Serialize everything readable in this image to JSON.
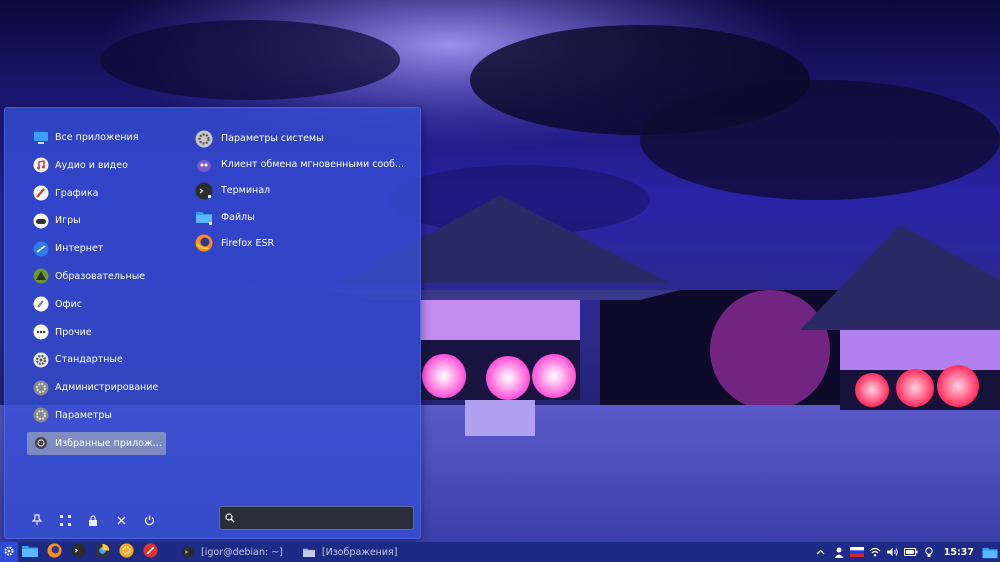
{
  "menu": {
    "categories": [
      {
        "label": "Все приложения",
        "icon": "monitor-icon"
      },
      {
        "label": "Аудио и видео",
        "icon": "music-note-icon"
      },
      {
        "label": "Графика",
        "icon": "graphics-icon"
      },
      {
        "label": "Игры",
        "icon": "gamepad-icon"
      },
      {
        "label": "Интернет",
        "icon": "internet-icon"
      },
      {
        "label": "Образовательные",
        "icon": "education-icon"
      },
      {
        "label": "Офис",
        "icon": "office-icon"
      },
      {
        "label": "Прочие",
        "icon": "more-icon"
      },
      {
        "label": "Стандартные",
        "icon": "gear-icon"
      },
      {
        "label": "Администрирование",
        "icon": "admin-gear-icon"
      },
      {
        "label": "Параметры",
        "icon": "settings-icon"
      },
      {
        "label": "Избранные приложе...",
        "icon": "favorites-icon"
      }
    ],
    "active_category": "Избранные приложе...",
    "apps": [
      {
        "label": "Параметры системы",
        "icon": "system-settings-icon"
      },
      {
        "label": "Клиент обмена мгновенными сооб...",
        "icon": "messenger-icon"
      },
      {
        "label": "Терминал",
        "icon": "terminal-icon"
      },
      {
        "label": "Файлы",
        "icon": "folder-icon"
      },
      {
        "label": "Firefox ESR",
        "icon": "firefox-icon"
      }
    ],
    "actions": [
      {
        "name": "pin-icon"
      },
      {
        "name": "apps-grid-icon"
      },
      {
        "name": "lock-icon"
      },
      {
        "name": "logout-icon"
      },
      {
        "name": "power-icon"
      }
    ],
    "search": {
      "value": "",
      "placeholder": ""
    }
  },
  "taskbar": {
    "tasks": [
      {
        "label": "[igor@debian: ~]",
        "icon": "terminal-icon"
      },
      {
        "label": "[Изображения]",
        "icon": "folder-icon"
      }
    ],
    "clock": "15:37",
    "colors": {
      "bar": "#1d2a86",
      "menu": "#344ed2",
      "accent": "#2d4ad6"
    }
  }
}
